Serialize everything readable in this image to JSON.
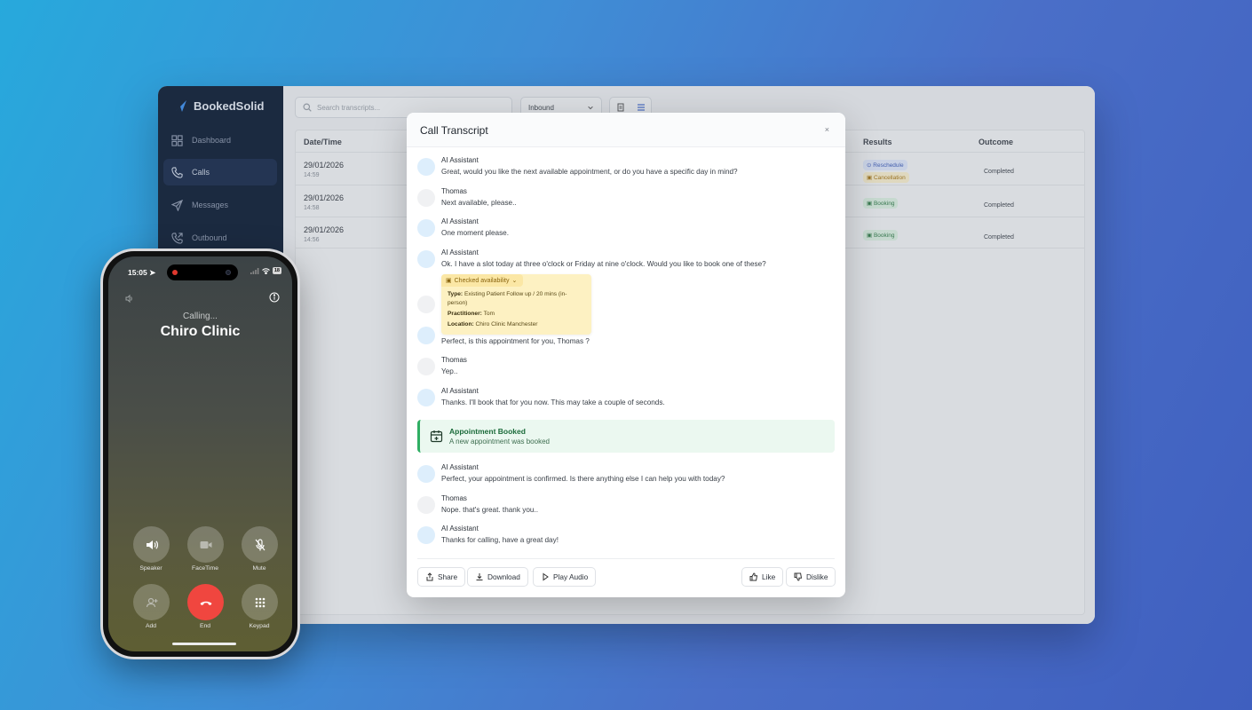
{
  "app": {
    "brand": "BookedSolid",
    "colors": {
      "sidebar": "#0c1b33",
      "accent": "#2f80ed",
      "success": "#2fae63",
      "end_call": "#f0463f"
    }
  },
  "sidebar": {
    "items": [
      {
        "label": "Dashboard",
        "icon": "grid-icon"
      },
      {
        "label": "Calls",
        "icon": "phone-icon",
        "active": true
      },
      {
        "label": "Messages",
        "icon": "send-icon"
      },
      {
        "label": "Outbound",
        "icon": "phone-outgoing-icon"
      }
    ]
  },
  "toolbar": {
    "search_placeholder": "Search transcripts...",
    "direction_select": "Inbound"
  },
  "table": {
    "headers": {
      "datetime": "Date/Time",
      "results": "Results",
      "outcome": "Outcome"
    },
    "rows": [
      {
        "date": "29/01/2026",
        "time": "14:59",
        "badges": [
          "Reschedule",
          "Cancellation"
        ],
        "outcome": "Completed"
      },
      {
        "date": "29/01/2026",
        "time": "14:58",
        "badges": [
          "Booking"
        ],
        "outcome": "Completed"
      },
      {
        "date": "29/01/2026",
        "time": "14:56",
        "badges": [
          "Booking"
        ],
        "outcome": "Completed"
      }
    ]
  },
  "modal": {
    "title": "Call Transcript",
    "close": "×",
    "messages": [
      {
        "speaker": "AI Assistant",
        "text": "Great, would you like the next available appointment, or do you have a specific day in mind?"
      },
      {
        "speaker": "Thomas",
        "text": "Next available, please.."
      },
      {
        "speaker": "AI Assistant",
        "text": "One moment please."
      },
      {
        "speaker": "AI Assistant",
        "text": "Ok. I have a slot today at three o'clock or Friday at nine o'clock. Would you like to book one of these?"
      },
      {
        "speaker": "",
        "text": ""
      },
      {
        "speaker": "",
        "text": "Perfect, is this appointment for you, Thomas ?"
      },
      {
        "speaker": "Thomas",
        "text": "Yep.."
      },
      {
        "speaker": "AI Assistant",
        "text": "Thanks. I'll book that for you now. This may take a couple of seconds."
      },
      {
        "speaker": "AI Assistant",
        "text": "Perfect, your appointment is confirmed. Is there anything else I can help you with today?"
      },
      {
        "speaker": "Thomas",
        "text": "Nope. that's great. thank you.."
      },
      {
        "speaker": "AI Assistant",
        "text": "Thanks for calling, have a great day!"
      }
    ],
    "tool_call": {
      "label": "Checked availability",
      "type_label": "Type:",
      "type_value": "Existing Patient Follow up / 20 mins (in-",
      "type_value_2": "person)",
      "practitioner_label": "Practitioner:",
      "practitioner_value": "Tom",
      "location_label": "Location:",
      "location_value": "Chiro Clinic Manchester"
    },
    "event": {
      "title": "Appointment Booked",
      "subtitle": "A new appointment was booked"
    },
    "actions": {
      "share": "Share",
      "download": "Download",
      "play_audio": "Play Audio",
      "like": "Like",
      "dislike": "Dislike"
    }
  },
  "phone": {
    "time": "15:05",
    "battery": "18",
    "status": "Calling...",
    "caller": "Chiro Clinic",
    "buttons": {
      "speaker": "Speaker",
      "facetime": "FaceTime",
      "mute": "Mute",
      "add": "Add",
      "end": "End",
      "keypad": "Keypad"
    }
  }
}
